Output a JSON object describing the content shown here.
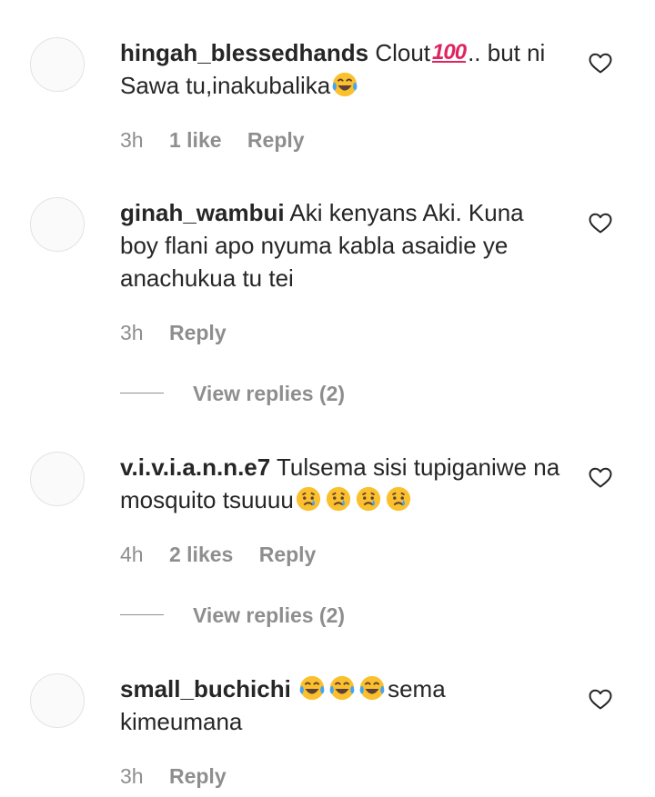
{
  "comments": [
    {
      "username": "hingah_blessedhands",
      "text_before": "Clout",
      "inline_emoji": "💯",
      "text_after": ".. but ni Sawa tu,inakubalika",
      "trailing_emojis": [
        "tears-of-joy"
      ],
      "time": "3h",
      "likes": "1 like",
      "reply": "Reply"
    },
    {
      "username": "ginah_wambui",
      "text": "Aki kenyans Aki. Kuna boy flani apo nyuma kabla asaidie ye anachukua tu tei",
      "time": "3h",
      "reply": "Reply",
      "view_replies": "View replies (2)"
    },
    {
      "username": "v.i.v.i.a.n.n.e7",
      "text": "Tulsema sisi tupiganiwe na mosquito tsuuuu",
      "trailing_emojis": [
        "crying-face",
        "crying-face",
        "crying-face",
        "crying-face"
      ],
      "time": "4h",
      "likes": "2 likes",
      "reply": "Reply",
      "view_replies": "View replies (2)"
    },
    {
      "username": "small_buchichi",
      "leading_emojis": [
        "tears-of-joy",
        "tears-of-joy",
        "tears-of-joy"
      ],
      "text": "sema kimeumana",
      "time": "3h",
      "reply": "Reply"
    }
  ],
  "icons": {
    "like": "heart-outline-icon",
    "avatar": "default-avatar"
  },
  "colors": {
    "text": "#262626",
    "muted": "#8e8e8e",
    "avatar_border": "#e3e3e3",
    "hundred": "#e0245e",
    "emoji_face": "#fbc02d"
  }
}
